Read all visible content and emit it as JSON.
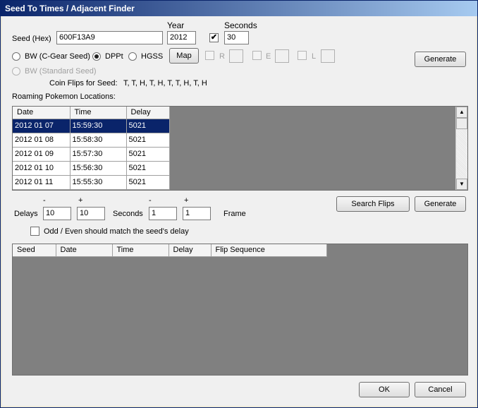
{
  "window": {
    "title": "Seed To Times / Adjacent Finder"
  },
  "seed": {
    "label": "Seed (Hex)",
    "value": "600F13A9"
  },
  "year": {
    "label": "Year",
    "value": "2012"
  },
  "seconds": {
    "label": "Seconds",
    "checked": true,
    "check_mark": "✔",
    "value": "30"
  },
  "version": {
    "bw_cgear": "BW (C-Gear Seed)",
    "dppt": "DPPt",
    "hgss": "HGSS",
    "bw_standard": "BW (Standard Seed)",
    "selected": "DPPt"
  },
  "map_button": "Map",
  "roamer_boxes": [
    {
      "label": "R",
      "value": ""
    },
    {
      "label": "E",
      "value": ""
    },
    {
      "label": "L",
      "value": ""
    }
  ],
  "generate_top": "Generate",
  "coin_flips": {
    "label": "Coin Flips for Seed:",
    "value": "T, T, H, T, H, T, T, H, T, H"
  },
  "roaming_label": "Roaming Pokemon Locations:",
  "roaming_table": {
    "columns": [
      "Date",
      "Time",
      "Delay"
    ],
    "rows": [
      [
        "2012 01 07",
        "15:59:30",
        "5021"
      ],
      [
        "2012 01 08",
        "15:58:30",
        "5021"
      ],
      [
        "2012 01 09",
        "15:57:30",
        "5021"
      ],
      [
        "2012 01 10",
        "15:56:30",
        "5021"
      ],
      [
        "2012 01 11",
        "15:55:30",
        "5021"
      ]
    ]
  },
  "search": {
    "minus": "-",
    "plus": "+",
    "delays_label": "Delays",
    "delays_minus": "10",
    "delays_plus": "10",
    "seconds_label": "Seconds",
    "seconds_minus": "1",
    "seconds_plus": "1",
    "frame_label": "Frame",
    "search_flips_button": "Search Flips",
    "generate_button": "Generate"
  },
  "odd_even": {
    "label": "Odd / Even should match the seed's delay",
    "checked": false
  },
  "results_table": {
    "columns": [
      "Seed",
      "Date",
      "Time",
      "Delay",
      "Flip Sequence"
    ]
  },
  "ok_button": "OK",
  "cancel_button": "Cancel"
}
